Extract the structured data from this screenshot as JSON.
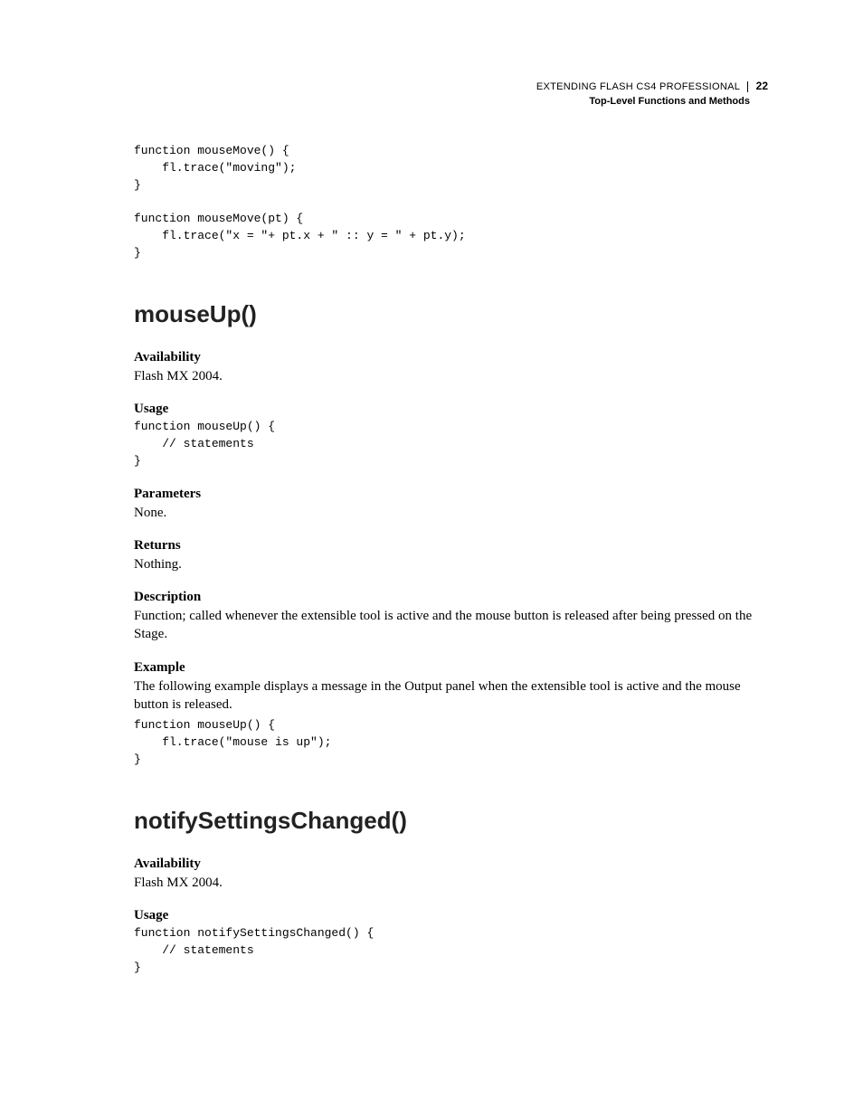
{
  "header": {
    "title": "EXTENDING FLASH CS4 PROFESSIONAL",
    "page_number": "22",
    "subtitle": "Top-Level Functions and Methods"
  },
  "intro_code": "function mouseMove() {\n    fl.trace(\"moving\");\n}\n\nfunction mouseMove(pt) {\n    fl.trace(\"x = \"+ pt.x + \" :: y = \" + pt.y);\n}",
  "section1": {
    "heading": "mouseUp()",
    "availability_label": "Availability",
    "availability_text": "Flash MX 2004.",
    "usage_label": "Usage",
    "usage_code": "function mouseUp() {\n    // statements\n}",
    "parameters_label": "Parameters",
    "parameters_text": "None.",
    "returns_label": "Returns",
    "returns_text": "Nothing.",
    "description_label": "Description",
    "description_text": "Function; called whenever the extensible tool is active and the mouse button is released after being pressed on the Stage.",
    "example_label": "Example",
    "example_text": "The following example displays a message in the Output panel when the extensible tool is active and the mouse button is released.",
    "example_code": "function mouseUp() {\n    fl.trace(\"mouse is up\");\n}"
  },
  "section2": {
    "heading": "notifySettingsChanged()",
    "availability_label": "Availability",
    "availability_text": "Flash MX 2004.",
    "usage_label": "Usage",
    "usage_code": "function notifySettingsChanged() {\n    // statements\n}"
  }
}
